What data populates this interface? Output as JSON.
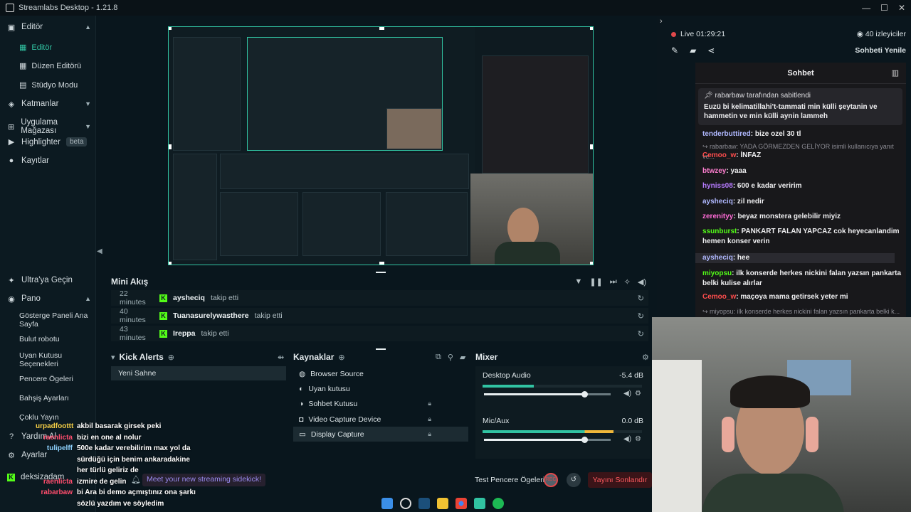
{
  "window": {
    "title": "Streamlabs Desktop - 1.21.8"
  },
  "sidebar": {
    "editor_header": "Editör",
    "editor_items": [
      "Editör",
      "Düzen Editörü",
      "Stüdyo Modu"
    ],
    "layers": "Katmanlar",
    "app_store": "Uygulama Mağazası",
    "highlighter": "Highlighter",
    "highlighter_badge": "beta",
    "recordings": "Kayıtlar",
    "ultra": "Ultra'ya Geçin",
    "dashboard": "Pano",
    "dashboard_items": [
      "Gösterge Paneli Ana Sayfa",
      "Bulut robotu",
      "Uyan Kutusu Seçenekleri",
      "Pencere Ögeleri",
      "Bahşiş Ayarları",
      "Çoklu Yayın"
    ],
    "help": "Yardım Al",
    "settings": "Ayarlar",
    "user": "deksizadam"
  },
  "mini_feed": {
    "title": "Mini Akış",
    "rows": [
      {
        "time": "22 minutes",
        "user": "aysheciq",
        "action": "takip etti"
      },
      {
        "time": "40 minutes",
        "user": "Tuanasurelywasthere",
        "action": "takip etti"
      },
      {
        "time": "43 minutes",
        "user": "Ireppa",
        "action": "takip etti"
      }
    ]
  },
  "scenes": {
    "title": "Kick Alerts",
    "items": [
      "Yeni Sahne"
    ]
  },
  "sources": {
    "title": "Kaynaklar",
    "items": [
      "Browser Source",
      "Uyan kutusu",
      "Sohbet Kutusu",
      "Video Capture Device",
      "Display Capture"
    ]
  },
  "mixer": {
    "title": "Mixer",
    "channels": [
      {
        "name": "Desktop Audio",
        "db": "-5.4 dB",
        "level": 0.32,
        "volume": 0.8
      },
      {
        "name": "Mic/Aux",
        "db": "0.0 dB",
        "level": 0.82,
        "volume": 0.8
      }
    ]
  },
  "footer": {
    "test_widgets": "Test Pencere Ögeleri",
    "rec": "REC",
    "end_stream": "Yayını Sonlandır",
    "sidekick": "Meet your new streaming sidekick!"
  },
  "overlay_chat": [
    {
      "user": "urpadfoottt",
      "msg": "akbil basarak girsek peki",
      "color": "#f7d046"
    },
    {
      "user": "raenlicta",
      "msg": "bizi en one al nolur",
      "color": "#ff4d6d"
    },
    {
      "user": "tulipelff",
      "msg": "500e kadar verebilirim max yol da",
      "color": "#8fd3ff"
    },
    {
      "user": "",
      "msg": "sürdüğü için benim ankaradakine",
      "color": "#ffffff"
    },
    {
      "user": "",
      "msg": "her türlü geliriz de",
      "color": "#ffffff"
    },
    {
      "user": "raenlicta",
      "msg": "izmire de gelin",
      "color": "#ff4d6d"
    },
    {
      "user": "rabarbaw",
      "msg": "bi Ara bi demo açmıştınız ona şarkı",
      "color": "#ff4d6d"
    },
    {
      "user": "",
      "msg": "sözlü yazdım ve söyledim",
      "color": "#ffffff"
    }
  ],
  "right": {
    "live": "Live 01:29:21",
    "viewers": "40 izleyiciler",
    "refresh": "Sohbeti Yenile",
    "chat_title": "Sohbet",
    "pinned_by": "rabarbaw tarafından sabitlendi",
    "pinned_msg": "Euzü bi kelimatillahi't-tammati min külli şeytanin ve hammetin ve min külli aynin lammeh",
    "messages": [
      {
        "user": "tenderbuttired",
        "color": "#b0b8ff",
        "msg": "bize ozel 30 tl",
        "type": "msg"
      },
      {
        "user": "",
        "color": "#8c8c94",
        "msg": "rabarbaw: YADA GÖRMEZDEN GELİYOR isimli kullanıcıya yanıt ve...",
        "type": "reply"
      },
      {
        "user": "Cemoo_w",
        "color": "#ff4d4d",
        "msg": "İNFAZ",
        "type": "msg"
      },
      {
        "user": "btwzey",
        "color": "#ff7fd0",
        "msg": "yaaa",
        "type": "msg"
      },
      {
        "user": "hyniss08",
        "color": "#b77bff",
        "msg": "600 e kadar veririm",
        "type": "msg"
      },
      {
        "user": "aysheciq",
        "color": "#b0b8ff",
        "msg": "zil nedir",
        "type": "msg"
      },
      {
        "user": "zerenityy",
        "color": "#ff6bd6",
        "msg": "beyaz monstera gelebilir miyiz",
        "type": "msg"
      },
      {
        "user": "ssunburst",
        "color": "#53fc18",
        "msg": "PANKART FALAN YAPCAZ cok heyecanlandim hemen konser verin",
        "type": "msg"
      },
      {
        "user": "aysheciq",
        "color": "#b0b8ff",
        "msg": "hee",
        "type": "hl"
      },
      {
        "user": "miyopsu",
        "color": "#53fc18",
        "msg": "ilk konserde herkes nickini falan yazsın pankarta belki kulise alırlar",
        "type": "msg"
      },
      {
        "user": "Cemoo_w",
        "color": "#ff4d4d",
        "msg": "maçoya mama getirsek yeter mi",
        "type": "msg"
      },
      {
        "user": "",
        "color": "#8c8c94",
        "msg": "miyopsu: ilk konserde herkes nickini falan yazsın pankarta belki k...",
        "type": "reply"
      }
    ]
  },
  "colors": {
    "accent": "#31c3a2",
    "kick": "#53fc18",
    "live": "#e0484b"
  }
}
